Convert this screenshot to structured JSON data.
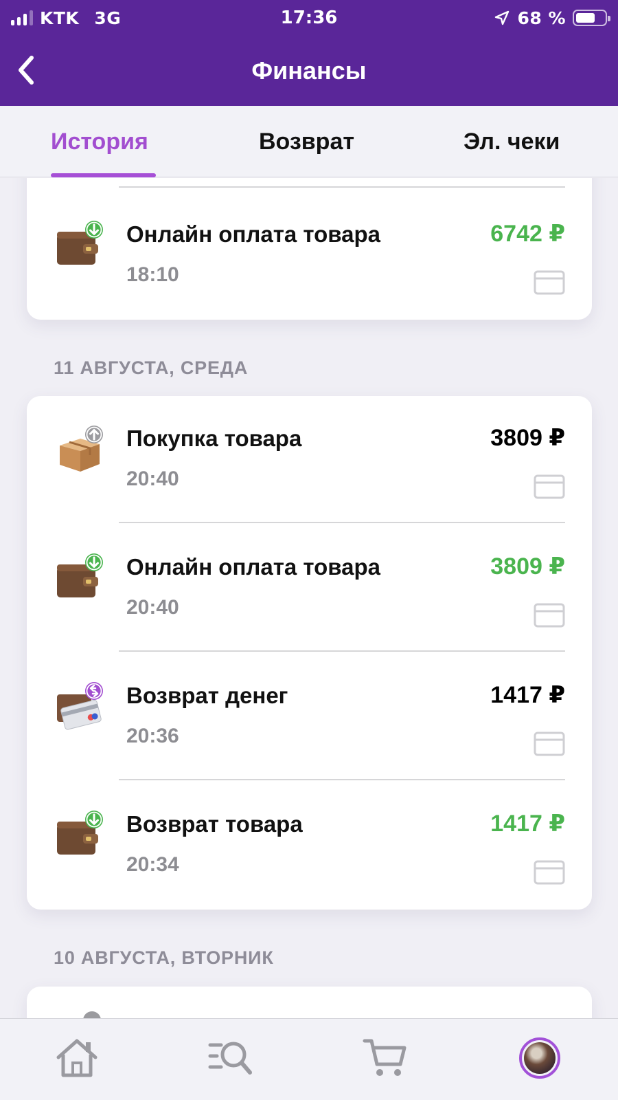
{
  "status_bar": {
    "carrier": "KTK",
    "network": "3G",
    "time": "17:36",
    "battery": "68 %",
    "battery_level": 0.68
  },
  "header": {
    "title": "Финансы",
    "back_icon": "chevron-left-icon"
  },
  "tabs": [
    {
      "label": "История",
      "active": true
    },
    {
      "label": "Возврат",
      "active": false
    },
    {
      "label": "Эл. чеки",
      "active": false
    }
  ],
  "colors": {
    "header_bg": "#5a2699",
    "accent": "#a64fd6",
    "amount_green": "#4ab44e",
    "muted_text": "#8d8d92"
  },
  "groups": [
    {
      "date": "",
      "transactions": [
        {
          "icon": "wallet-income-icon",
          "title": "Онлайн оплата товара",
          "time": "18:10",
          "amount": "6742 ₽",
          "amount_color": "green",
          "payment_icon": "bank-card-icon"
        }
      ]
    },
    {
      "date": "11 АВГУСТА, СРЕДА",
      "transactions": [
        {
          "icon": "parcel-outgoing-icon",
          "title": "Покупка товара",
          "time": "20:40",
          "amount": "3809 ₽",
          "amount_color": "black",
          "payment_icon": "bank-card-icon"
        },
        {
          "icon": "wallet-income-icon",
          "title": "Онлайн оплата товара",
          "time": "20:40",
          "amount": "3809 ₽",
          "amount_color": "green",
          "payment_icon": "bank-card-icon"
        },
        {
          "icon": "card-refund-icon",
          "title": "Возврат денег",
          "time": "20:36",
          "amount": "1417 ₽",
          "amount_color": "black",
          "payment_icon": "bank-card-icon"
        },
        {
          "icon": "wallet-income-icon",
          "title": "Возврат товара",
          "time": "20:34",
          "amount": "1417 ₽",
          "amount_color": "green",
          "payment_icon": "bank-card-icon"
        }
      ]
    },
    {
      "date": "10 АВГУСТА, ВТОРНИК",
      "transactions": []
    }
  ],
  "bottom_nav": [
    {
      "icon": "home-icon"
    },
    {
      "icon": "catalog-search-icon"
    },
    {
      "icon": "cart-icon"
    },
    {
      "icon": "profile-avatar-icon",
      "active": true
    }
  ]
}
